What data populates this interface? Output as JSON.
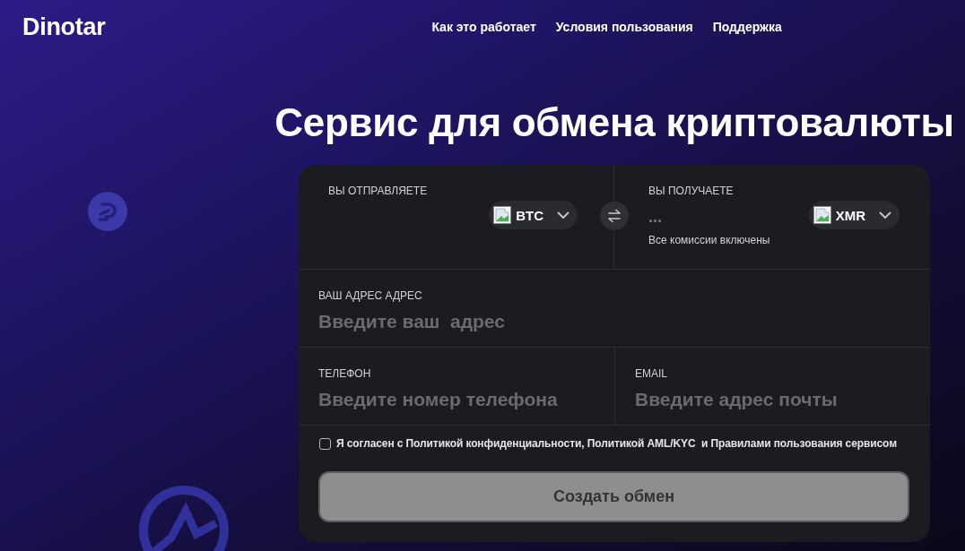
{
  "header": {
    "logo": "Dinotar",
    "nav": [
      "Как это работает",
      "Условия пользования",
      "Поддержка"
    ]
  },
  "hero": {
    "title": "Сервис для обмена криптовалюты"
  },
  "exchange": {
    "send": {
      "label": "ВЫ ОТПРАВЛЯЕТЕ",
      "currency": "BTC"
    },
    "receive": {
      "label": "ВЫ ПОЛУЧАЕТЕ",
      "amount": "...",
      "currency": "XMR",
      "note": "Все комиссии включены"
    },
    "fields": [
      {
        "kind": "wide",
        "label": "ВАШ АДРЕС АДРЕС",
        "placeholder": "Введите ваш  адрес"
      },
      {
        "kind": "half",
        "label": "ТЕЛЕФОН",
        "placeholder": "Введите номер телефона"
      },
      {
        "kind": "half",
        "label": "EMAIL",
        "placeholder": "Введите адрес почты"
      }
    ],
    "agreement": {
      "text": "Я согласен с Политикой конфиденциальности, Политикой AML/KYC  и Правилами пользования сервисом",
      "checked": false
    },
    "submit": {
      "label": "Создать обмен",
      "disabled": true
    }
  }
}
